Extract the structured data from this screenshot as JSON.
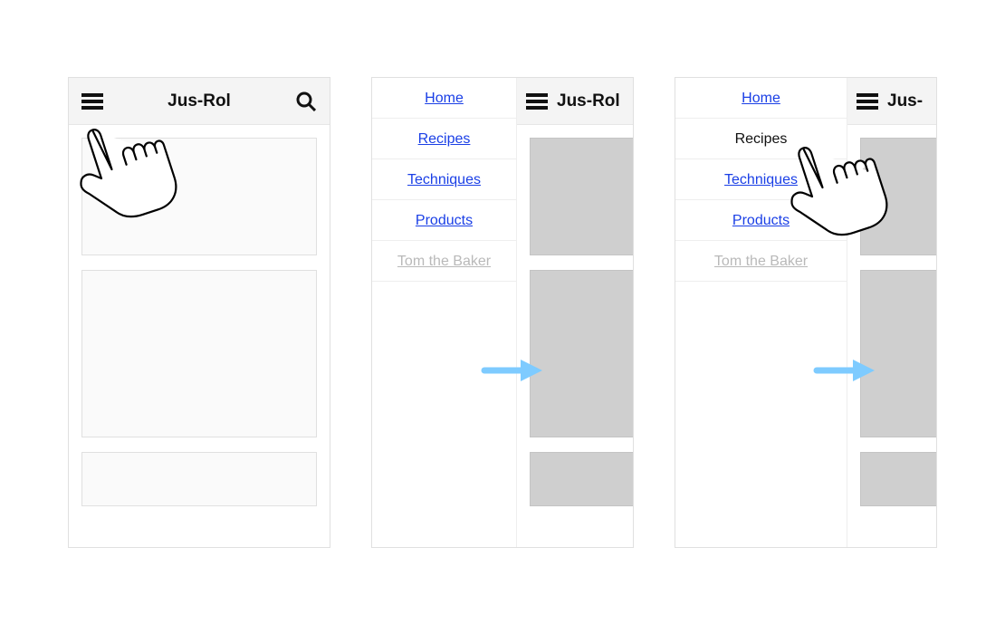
{
  "app": {
    "title": "Jus-Rol",
    "title_clipped_2": "Jus-Rol",
    "title_clipped_3": "Jus-"
  },
  "drawer": {
    "items": [
      {
        "label": "Home"
      },
      {
        "label": "Recipes"
      },
      {
        "label": "Techniques"
      },
      {
        "label": "Products"
      },
      {
        "label": "Tom the Baker"
      }
    ]
  }
}
